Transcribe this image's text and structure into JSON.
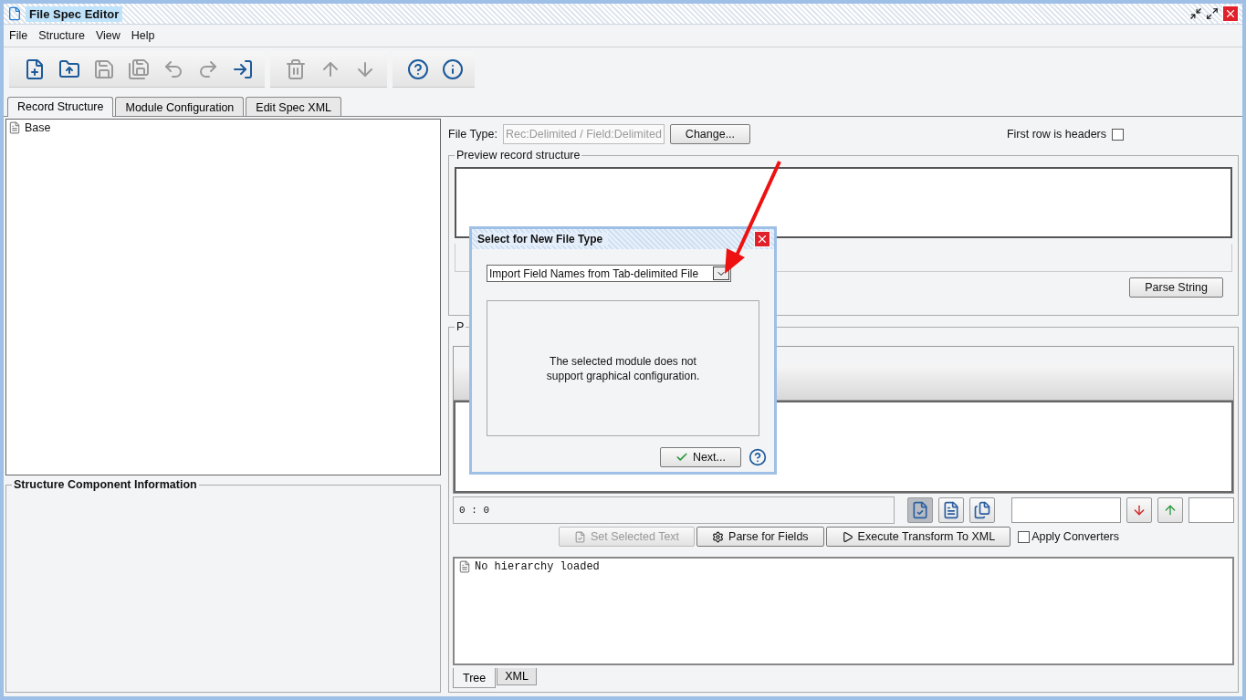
{
  "window": {
    "title": "File Spec Editor"
  },
  "menu": [
    "File",
    "Structure",
    "View",
    "Help"
  ],
  "toolbar": [
    [
      {
        "kind": "new",
        "disabled": false
      },
      {
        "kind": "open",
        "disabled": false
      },
      {
        "kind": "save",
        "disabled": true
      },
      {
        "kind": "saveas",
        "disabled": true
      },
      {
        "kind": "undo",
        "disabled": true
      },
      {
        "kind": "redo",
        "disabled": true
      },
      {
        "kind": "exit",
        "disabled": false
      }
    ],
    [
      {
        "kind": "delete",
        "disabled": true
      },
      {
        "kind": "up",
        "disabled": true
      },
      {
        "kind": "down",
        "disabled": true
      }
    ],
    [
      {
        "kind": "help",
        "disabled": false
      },
      {
        "kind": "info",
        "disabled": false
      }
    ]
  ],
  "tabs": [
    {
      "label": "Record Structure",
      "selected": true
    },
    {
      "label": "Module Configuration",
      "selected": false
    },
    {
      "label": "Edit Spec XML",
      "selected": false
    }
  ],
  "tree": [
    {
      "label": "Base"
    }
  ],
  "info_panel": {
    "title": "Structure Component Information"
  },
  "file_type": {
    "label": "File Type:",
    "value": "Rec:Delimited / Field:Delimited",
    "button": "Change..."
  },
  "first_row_headers": {
    "label": "First row is headers",
    "checked": false
  },
  "preview": {
    "title": "Preview record structure",
    "button": "Parse String"
  },
  "parse_panel": {
    "title": "P"
  },
  "position": "0 : 0",
  "view_buttons": [
    {
      "selected": true
    },
    {
      "selected": false
    },
    {
      "selected": false
    }
  ],
  "actions": [
    {
      "label": "Set Selected Text",
      "disabled": true
    },
    {
      "label": "Parse for Fields",
      "disabled": false
    },
    {
      "label": "Execute Transform To XML",
      "disabled": false
    }
  ],
  "apply_converters": {
    "label": "Apply Converters",
    "checked": false
  },
  "result_tree": [
    {
      "label": "No hierarchy loaded"
    }
  ],
  "result_tabs": [
    {
      "label": "Tree",
      "selected": true
    },
    {
      "label": "XML",
      "selected": false
    }
  ],
  "dialog": {
    "title": "Select for New File Type",
    "combo": "Import Field Names from Tab-delimited File",
    "message": "The selected module does not support graphical configuration.",
    "button": "Next..."
  }
}
